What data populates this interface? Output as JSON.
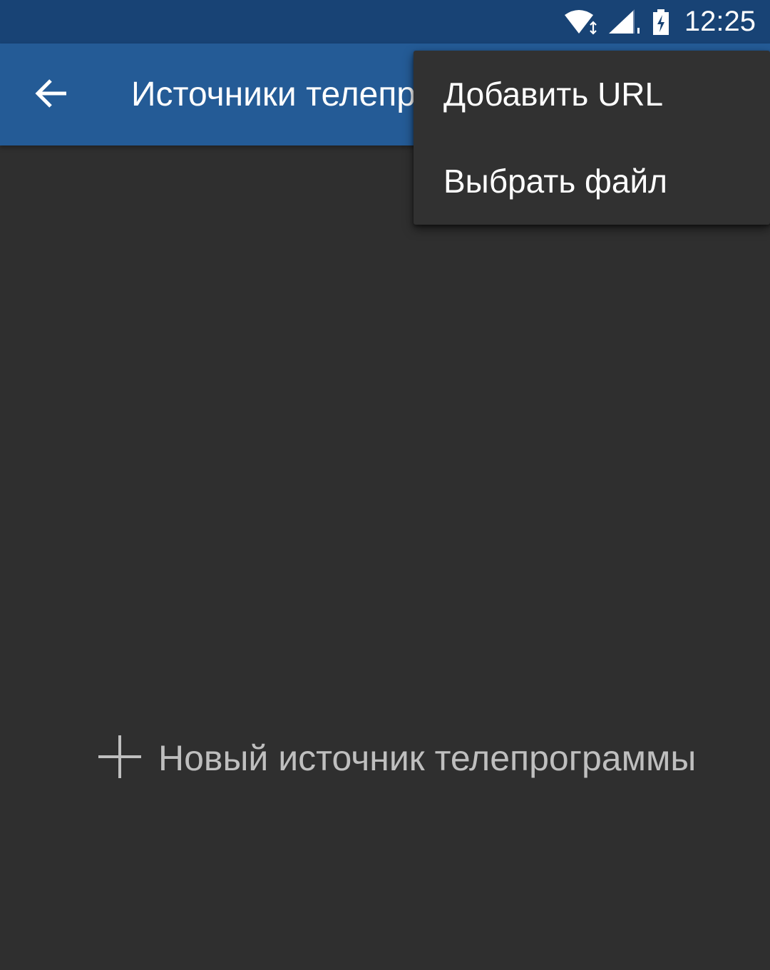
{
  "status_bar": {
    "time": "12:25",
    "icons": [
      "wifi-icon",
      "cell-signal-icon",
      "battery-charging-icon"
    ]
  },
  "app_bar": {
    "title": "Источники телепрограммы",
    "back_icon": "arrow-back-icon",
    "background_color": "#245b96"
  },
  "overflow_menu": {
    "items": [
      {
        "label": "Добавить URL"
      },
      {
        "label": "Выбрать файл"
      }
    ]
  },
  "main": {
    "add_source_label": "Новый источник телепрограммы",
    "add_icon": "plus-icon"
  },
  "colors": {
    "status_bar": "#184375",
    "background": "#2f2f2f",
    "menu_background": "#313131"
  }
}
